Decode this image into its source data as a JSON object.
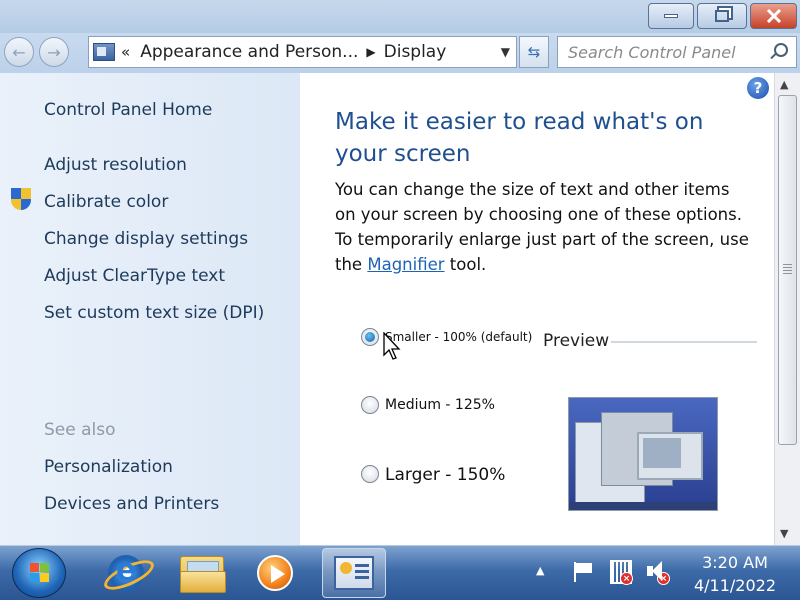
{
  "window": {
    "address": {
      "sep": "«",
      "crumbs": [
        "Appearance and Person...",
        "Display"
      ]
    },
    "search_placeholder": "Search Control Panel"
  },
  "sidebar": {
    "home": "Control Panel Home",
    "items": [
      {
        "label": "Adjust resolution",
        "icon": null
      },
      {
        "label": "Calibrate color",
        "icon": "uac-shield-icon"
      },
      {
        "label": "Change display settings",
        "icon": null
      },
      {
        "label": "Adjust ClearType text",
        "icon": null
      },
      {
        "label": "Set custom text size (DPI)",
        "icon": null
      }
    ],
    "see_also_label": "See also",
    "see_also": [
      "Personalization",
      "Devices and Printers"
    ]
  },
  "main": {
    "heading": "Make it easier to read what's on your screen",
    "body_pre": "You can change the size of text and other items on your screen by choosing one of these options. To temporarily enlarge just part of the screen, use the",
    "link": "Magnifier",
    "body_post": "tool.",
    "options": [
      {
        "label": "Smaller - 100% (default)",
        "selected": true
      },
      {
        "label": "Medium - 125%",
        "selected": false
      },
      {
        "label": "Larger - 150%",
        "selected": false
      }
    ],
    "preview_label": "Preview"
  },
  "taskbar": {
    "apps": [
      "start-orb",
      "internet-explorer",
      "windows-explorer",
      "windows-media-player",
      "display-control-panel"
    ],
    "active_app": "display-control-panel",
    "clock_time": "3:20 AM",
    "clock_date": "4/11/2022"
  },
  "colors": {
    "heading": "#1f4f8f",
    "link": "#1d63b6",
    "sidebar_text": "#1e3a5a",
    "sidebar_bg": "#dce8f6"
  }
}
